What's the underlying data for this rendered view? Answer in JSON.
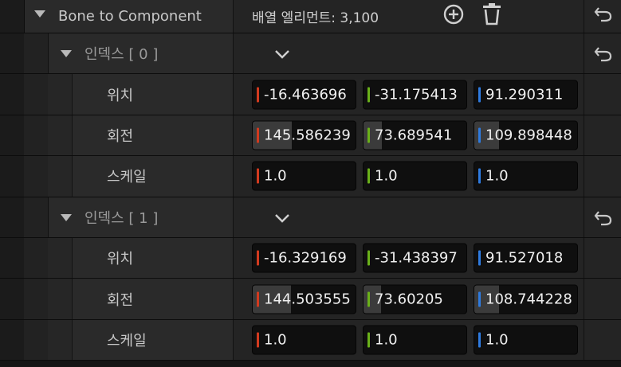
{
  "header": {
    "property_name": "Bone to Component",
    "count_label": "배열 엘리먼트: 3,100"
  },
  "colors": {
    "x": "#d23a1f",
    "y": "#6ab01a",
    "z": "#2e7be0"
  },
  "icons": {
    "expand": "triangle-down-icon",
    "add": "plus-circle-icon",
    "delete": "trash-icon",
    "reset": "reset-arrow-icon",
    "dropdown": "chevron-down-icon"
  },
  "elements": [
    {
      "label": "인덱스 [ 0 ]",
      "rows": [
        {
          "name": "위치",
          "x": "-16.463696",
          "y": "-31.175413",
          "z": "91.290311",
          "fx": 0,
          "fy": 0,
          "fz": 0
        },
        {
          "name": "회전",
          "x": "145.586239",
          "y": "73.689541",
          "z": "109.898448",
          "fx": 0.38,
          "fy": 0.18,
          "fz": 0.24
        },
        {
          "name": "스케일",
          "x": "1.0",
          "y": "1.0",
          "z": "1.0",
          "fx": 0,
          "fy": 0,
          "fz": 0
        }
      ]
    },
    {
      "label": "인덱스 [ 1 ]",
      "rows": [
        {
          "name": "위치",
          "x": "-16.329169",
          "y": "-31.438397",
          "z": "91.527018",
          "fx": 0,
          "fy": 0,
          "fz": 0
        },
        {
          "name": "회전",
          "x": "144.503555",
          "y": "73.60205",
          "z": "108.744228",
          "fx": 0.37,
          "fy": 0.17,
          "fz": 0.24
        },
        {
          "name": "스케일",
          "x": "1.0",
          "y": "1.0",
          "z": "1.0",
          "fx": 0,
          "fy": 0,
          "fz": 0
        }
      ]
    }
  ]
}
